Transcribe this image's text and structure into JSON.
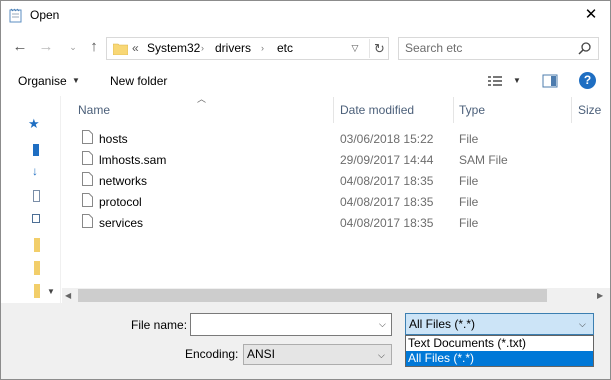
{
  "window": {
    "title": "Open"
  },
  "nav": {
    "address_overflow": "«",
    "breadcrumbs": [
      "System32",
      "drivers",
      "etc"
    ],
    "search_placeholder": "Search etc"
  },
  "toolbar": {
    "organise_label": "Organise",
    "new_folder_label": "New folder"
  },
  "columns": [
    "Name",
    "Date modified",
    "Type",
    "Size"
  ],
  "files": [
    {
      "name": "hosts",
      "date": "03/06/2018 15:22",
      "type": "File"
    },
    {
      "name": "lmhosts.sam",
      "date": "29/09/2017 14:44",
      "type": "SAM File"
    },
    {
      "name": "networks",
      "date": "04/08/2017 18:35",
      "type": "File"
    },
    {
      "name": "protocol",
      "date": "04/08/2017 18:35",
      "type": "File"
    },
    {
      "name": "services",
      "date": "04/08/2017 18:35",
      "type": "File"
    }
  ],
  "bottom": {
    "file_name_label": "File name:",
    "file_name_value": "",
    "file_type_selected": "All Files  (*.*)",
    "file_type_options": [
      "Text Documents (*.txt)",
      "All Files  (*.*)"
    ],
    "encoding_label": "Encoding:",
    "encoding_value": "ANSI"
  },
  "colors": {
    "accent": "#0078d7",
    "header_text": "#4c607a"
  }
}
